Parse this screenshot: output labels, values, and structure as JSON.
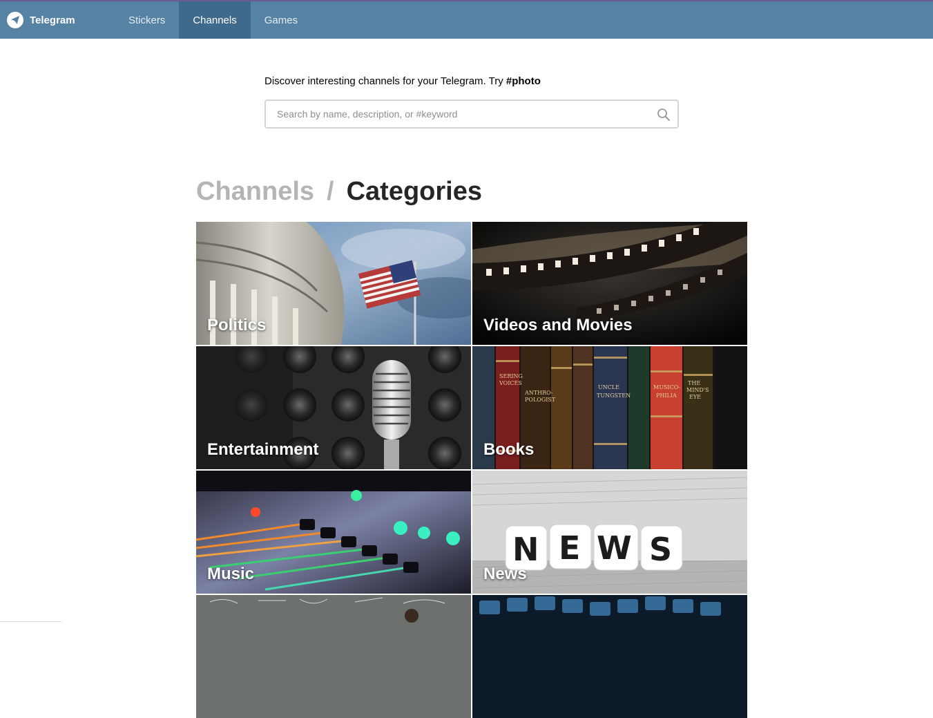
{
  "app": {
    "name": "Telegram"
  },
  "nav": {
    "items": [
      {
        "label": "Stickers",
        "active": false
      },
      {
        "label": "Channels",
        "active": true
      },
      {
        "label": "Games",
        "active": false
      }
    ]
  },
  "intro": {
    "text": "Discover interesting channels for your Telegram. Try ",
    "tag": "#photo"
  },
  "search": {
    "placeholder": "Search by name, description, or #keyword",
    "value": ""
  },
  "breadcrumb": {
    "parent": "Channels",
    "separator": "/",
    "current": "Categories"
  },
  "categories": [
    {
      "label": "Politics"
    },
    {
      "label": "Videos and Movies"
    },
    {
      "label": "Entertainment"
    },
    {
      "label": "Books"
    },
    {
      "label": "Music"
    },
    {
      "label": "News"
    },
    {
      "label": ""
    },
    {
      "label": ""
    }
  ],
  "news_tile": {
    "dice_letters": [
      "N",
      "E",
      "W",
      "S"
    ]
  },
  "colors": {
    "header": "#5682a3",
    "header_active": "#3f6a8c",
    "heading_muted": "#b4b4b4"
  }
}
